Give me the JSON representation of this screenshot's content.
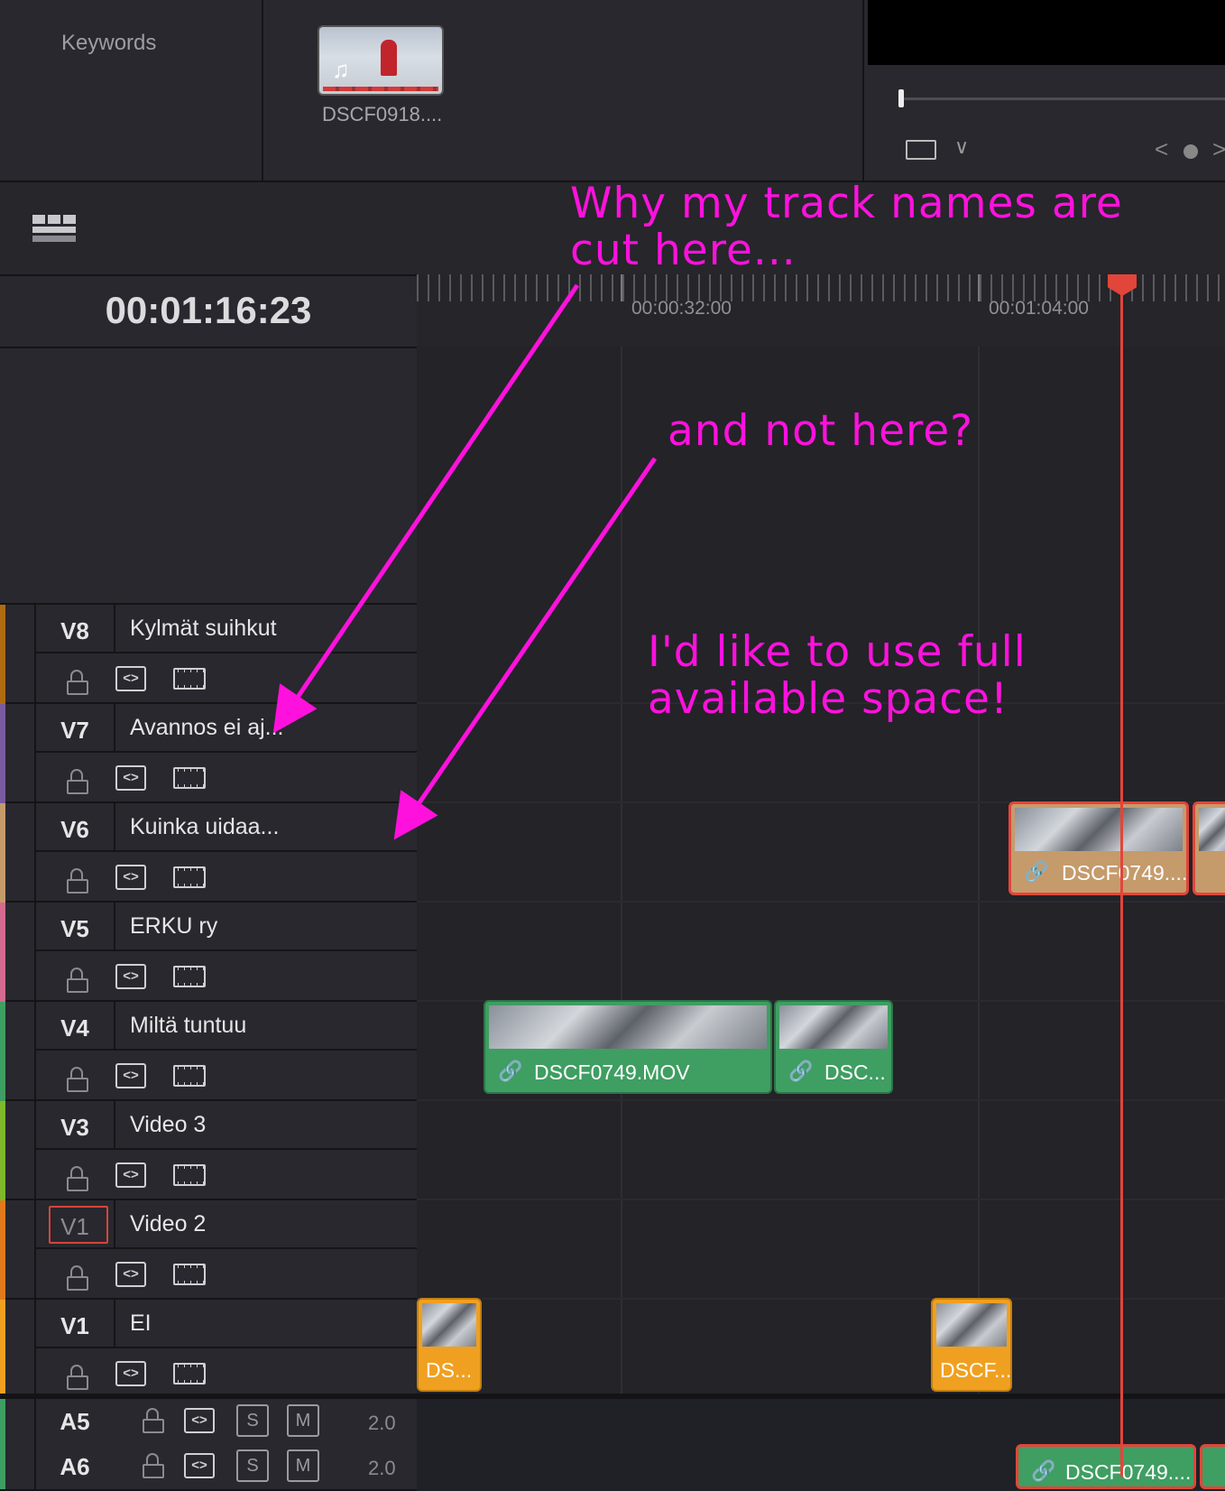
{
  "media_pool": {
    "keywords_label": "Keywords",
    "clip_name": "DSCF0918...."
  },
  "timeline": {
    "timecode": "00:01:16:23",
    "ruler_labels": [
      "00:00:32:00",
      "00:01:04:00"
    ],
    "video_tracks": [
      {
        "id": "V8",
        "name": "Kylmät suihkut",
        "color": "#b06a12"
      },
      {
        "id": "V7",
        "name": "Avannos ei aj...",
        "color": "#7a5aa0"
      },
      {
        "id": "V6",
        "name": "Kuinka uidaa...",
        "color": "#c59b6c"
      },
      {
        "id": "V5",
        "name": "ERKU ry",
        "color": "#d46a8e"
      },
      {
        "id": "V4",
        "name": "Miltä tuntuu",
        "color": "#3f9e62"
      },
      {
        "id": "V3",
        "name": "Video 3",
        "color": "#7fb82a"
      },
      {
        "id": "V1",
        "name": "Video 2",
        "color": "#e07a1c"
      },
      {
        "id": "V1",
        "name": "EI",
        "color": "#f0a020"
      }
    ],
    "clips": {
      "v6_clip": "DSCF0749....",
      "v4_clip_a": "DSCF0749.MOV",
      "v4_clip_b": "DSC...",
      "v1_clip_a": "DS...",
      "v1_clip_b": "DSCF..."
    },
    "audio_tracks": [
      {
        "id": "A5",
        "solo": "S",
        "mute": "M",
        "channels": "2.0"
      },
      {
        "id": "A6",
        "solo": "S",
        "mute": "M",
        "channels": "2.0"
      }
    ],
    "a6_clip": "DSCF0749...."
  },
  "annotations": {
    "note1_line1": "Why my track names are",
    "note1_line2": "cut here...",
    "note2": "and not here?",
    "note3_line1": "I'd like to use full",
    "note3_line2": "available space!",
    "color": "#ff11dd"
  },
  "icons": {
    "link": "🔗",
    "code": "<>",
    "music": "♫",
    "chevron": "∨",
    "prev": "<",
    "next": ">"
  }
}
